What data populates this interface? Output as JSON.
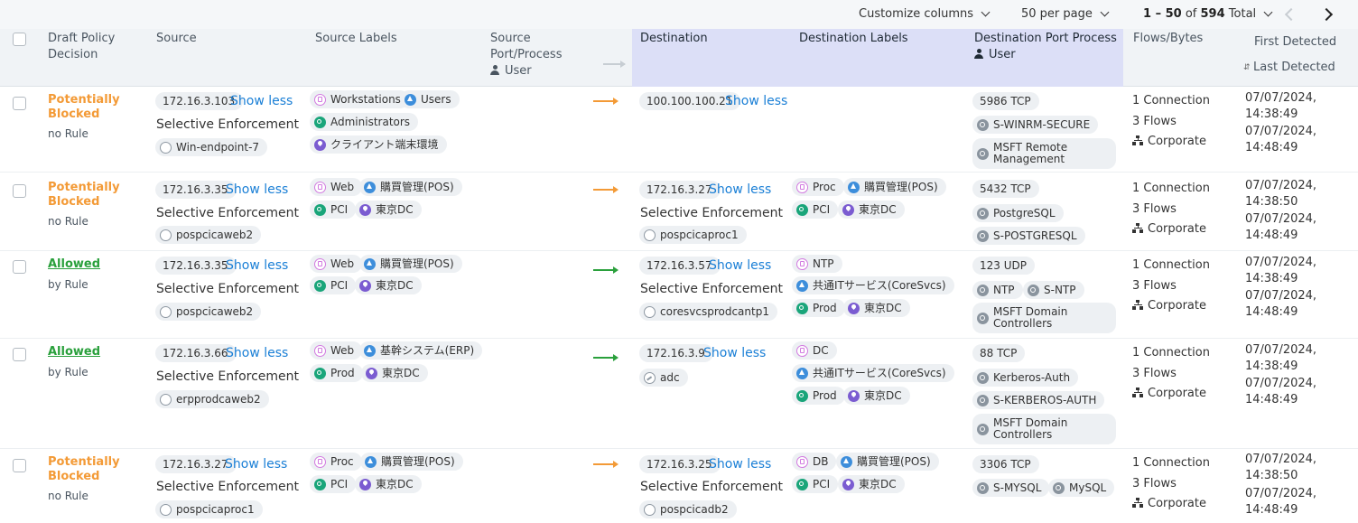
{
  "toolbar": {
    "customize_columns": "Customize columns",
    "per_page": "50 per page",
    "range": "1 – 50",
    "of": "of",
    "total_count": "594",
    "total_label": "Total"
  },
  "columns": {
    "draft_policy_decision": [
      "Draft Policy",
      "Decision"
    ],
    "source": "Source",
    "source_labels": "Source Labels",
    "source_port_process": [
      "Source",
      "Port/Process"
    ],
    "source_user": "User",
    "destination": "Destination",
    "destination_labels": "Destination Labels",
    "destination_port_process": "Destination Port Process",
    "destination_user": "User",
    "flows_bytes": "Flows/Bytes",
    "first_detected": "First Detected",
    "last_detected": "Last Detected"
  },
  "colors": {
    "potentially_blocked": "#f39a36",
    "allowed": "#2aa03c",
    "link": "#1a7fd6",
    "destination_header_bg": "#dcdff7"
  },
  "icons": {
    "role": "role-label-icon",
    "app": "application-label-icon",
    "env": "environment-label-icon",
    "loc": "location-label-icon",
    "workload": "workload-icon",
    "service": "service-icon",
    "network": "network-icon",
    "user": "user-icon"
  },
  "rows": [
    {
      "decision": [
        "Potentially",
        "Blocked"
      ],
      "decision_sub": "no Rule",
      "source_ip": "172.16.3.103",
      "source_show_less": "Show less",
      "source_enforcement": "Selective Enforcement",
      "source_workload": "Win-endpoint-7",
      "source_labels": [
        "Workstations",
        "Users",
        "Administrators",
        "クライアント端末環境"
      ],
      "destination_ip": "100.100.100.21",
      "destination_show_less": "Show less",
      "destination_labels": [],
      "port": "5986 TCP",
      "services": [
        "S-WINRM-SECURE",
        "MSFT Remote Management"
      ],
      "flows": [
        "1 Connection",
        "3 Flows",
        "Corporate"
      ],
      "first_detected": [
        "07/07/2024,",
        "14:38:49"
      ],
      "last_detected": [
        "07/07/2024,",
        "14:48:49"
      ]
    },
    {
      "decision": [
        "Potentially",
        "Blocked"
      ],
      "decision_sub": "no Rule",
      "source_ip": "172.16.3.35",
      "source_show_less": "Show less",
      "source_enforcement": "Selective Enforcement",
      "source_workload": "pospcicaweb2",
      "source_labels": [
        "Web",
        "購買管理(POS)",
        "PCI",
        "東京DC"
      ],
      "destination_ip": "172.16.3.27",
      "destination_show_less": "Show less",
      "destination_enforcement": "Selective Enforcement",
      "destination_workload": "pospcicaproc1",
      "destination_labels": [
        "Proc",
        "購買管理(POS)",
        "PCI",
        "東京DC"
      ],
      "port": "5432 TCP",
      "services": [
        "PostgreSQL",
        "S-POSTGRESQL"
      ],
      "flows": [
        "1 Connection",
        "3 Flows",
        "Corporate"
      ],
      "first_detected": [
        "07/07/2024,",
        "14:38:50"
      ],
      "last_detected": [
        "07/07/2024,",
        "14:48:49"
      ]
    },
    {
      "decision": [
        "Allowed"
      ],
      "decision_sub": "by Rule",
      "source_ip": "172.16.3.35",
      "source_show_less": "Show less",
      "source_enforcement": "Selective Enforcement",
      "source_workload": "pospcicaweb2",
      "source_labels": [
        "Web",
        "購買管理(POS)",
        "PCI",
        "東京DC"
      ],
      "destination_ip": "172.16.3.57",
      "destination_show_less": "Show less",
      "destination_enforcement": "Selective Enforcement",
      "destination_workload": "coresvcsprodcantp1",
      "destination_labels": [
        "NTP",
        "共通ITサービス(CoreSvcs)",
        "Prod",
        "東京DC"
      ],
      "port": "123 UDP",
      "services": [
        "NTP",
        "S-NTP",
        "MSFT Domain Controllers"
      ],
      "flows": [
        "1 Connection",
        "3 Flows",
        "Corporate"
      ],
      "first_detected": [
        "07/07/2024,",
        "14:38:49"
      ],
      "last_detected": [
        "07/07/2024,",
        "14:48:49"
      ]
    },
    {
      "decision": [
        "Allowed"
      ],
      "decision_sub": "by Rule",
      "source_ip": "172.16.3.66",
      "source_show_less": "Show less",
      "source_enforcement": "Selective Enforcement",
      "source_workload": "erpprodcaweb2",
      "source_labels": [
        "Web",
        "基幹システム(ERP)",
        "Prod",
        "東京DC"
      ],
      "destination_ip": "172.16.3.9",
      "destination_show_less": "Show less",
      "destination_workload": "adc",
      "destination_labels": [
        "DC",
        "共通ITサービス(CoreSvcs)",
        "Prod",
        "東京DC"
      ],
      "port": "88 TCP",
      "services": [
        "Kerberos-Auth",
        "S-KERBEROS-AUTH",
        "MSFT Domain Controllers"
      ],
      "flows": [
        "1 Connection",
        "3 Flows",
        "Corporate"
      ],
      "first_detected": [
        "07/07/2024,",
        "14:38:49"
      ],
      "last_detected": [
        "07/07/2024,",
        "14:48:49"
      ]
    },
    {
      "decision": [
        "Potentially",
        "Blocked"
      ],
      "decision_sub": "no Rule",
      "source_ip": "172.16.3.27",
      "source_show_less": "Show less",
      "source_enforcement": "Selective Enforcement",
      "source_workload": "pospcicaproc1",
      "source_labels": [
        "Proc",
        "購買管理(POS)",
        "PCI",
        "東京DC"
      ],
      "destination_ip": "172.16.3.25",
      "destination_show_less": "Show less",
      "destination_enforcement": "Selective Enforcement",
      "destination_workload": "pospcicadb2",
      "destination_labels": [
        "DB",
        "購買管理(POS)",
        "PCI",
        "東京DC"
      ],
      "port": "3306 TCP",
      "services": [
        "S-MYSQL",
        "MySQL"
      ],
      "flows": [
        "1 Connection",
        "3 Flows",
        "Corporate"
      ],
      "first_detected": [
        "07/07/2024,",
        "14:38:50"
      ],
      "last_detected": [
        "07/07/2024,",
        "14:48:49"
      ]
    }
  ]
}
